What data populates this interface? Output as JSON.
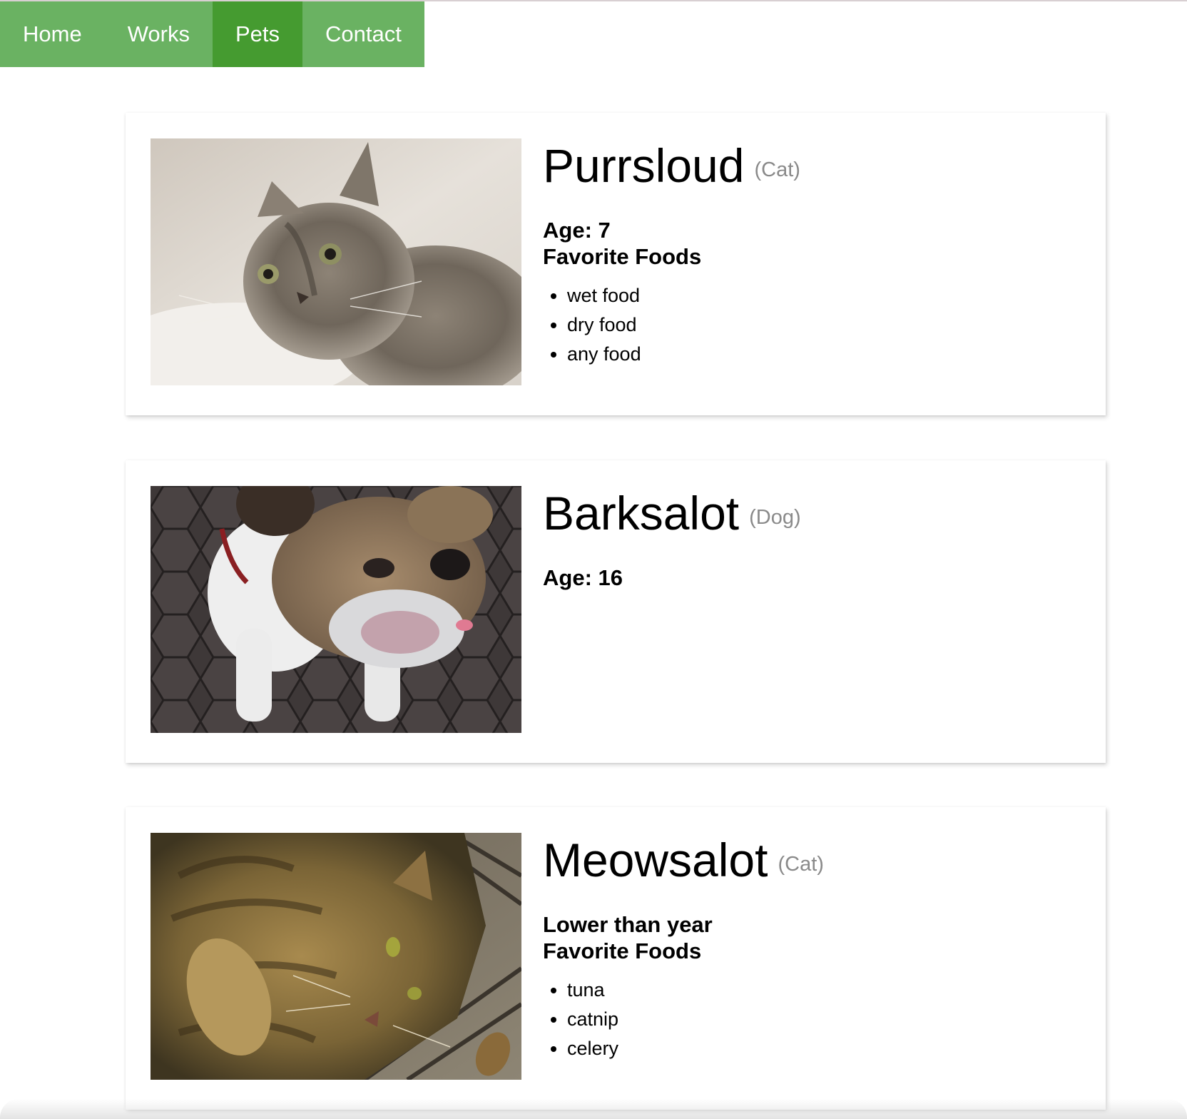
{
  "nav": {
    "items": [
      {
        "label": "Home"
      },
      {
        "label": "Works"
      },
      {
        "label": "Pets"
      },
      {
        "label": "Contact"
      }
    ],
    "active": "Pets",
    "colors": {
      "bar": "#6ab262",
      "active": "#459b30"
    }
  },
  "pets": [
    {
      "name": "Purrsloud",
      "species": "(Cat)",
      "age_line": "Age: 7",
      "foods_heading": "Favorite Foods",
      "foods": [
        "wet food",
        "dry food",
        "any food"
      ],
      "photo": "kitten-photo"
    },
    {
      "name": "Barksalot",
      "species": "(Dog)",
      "age_line": "Age: 16",
      "photo": "bulldog-photo"
    },
    {
      "name": "Meowsalot",
      "species": "(Cat)",
      "age_line": "Lower than year",
      "foods_heading": "Favorite Foods",
      "foods": [
        "tuna",
        "catnip",
        "celery"
      ],
      "photo": "tabby-cat-photo"
    }
  ]
}
